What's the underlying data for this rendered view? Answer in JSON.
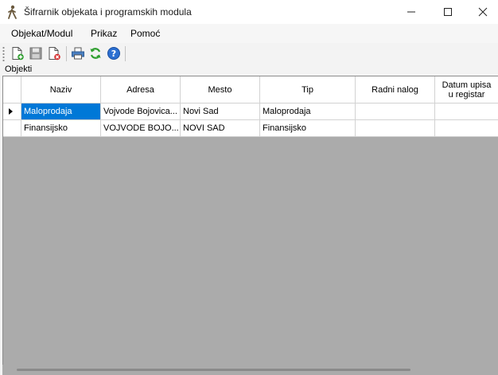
{
  "window": {
    "title": "Šifrarnik objekata i programskih modula",
    "app_icon": "person-walking-icon",
    "controls": [
      "minimize-icon",
      "maximize-icon",
      "close-icon"
    ]
  },
  "menu": {
    "items": [
      "Objekat/Modul",
      "Prikaz",
      "Pomoć"
    ]
  },
  "toolbar": {
    "buttons": [
      "new-document-icon",
      "save-icon",
      "delete-document-icon",
      "print-icon",
      "refresh-icon",
      "help-icon"
    ]
  },
  "section": {
    "label": "Objekti"
  },
  "grid": {
    "columns": [
      "Naziv",
      "Adresa",
      "Mesto",
      "Tip",
      "Radni nalog",
      "Datum upisa\nu registar"
    ],
    "rows": [
      {
        "naziv": "Maloprodaja",
        "adresa": "Vojvode Bojovica...",
        "mesto": "Novi Sad",
        "tip": "Maloprodaja",
        "radni_nalog": "",
        "datum": ""
      },
      {
        "naziv": "Finansijsko",
        "adresa": "VOJVODE BOJO...",
        "mesto": "NOVI SAD",
        "tip": "Finansijsko",
        "radni_nalog": "",
        "datum": ""
      }
    ],
    "current_row": 0,
    "selected_cell": "naziv",
    "colors": {
      "selection": "#0078d7",
      "empty_area": "#ababab"
    }
  }
}
